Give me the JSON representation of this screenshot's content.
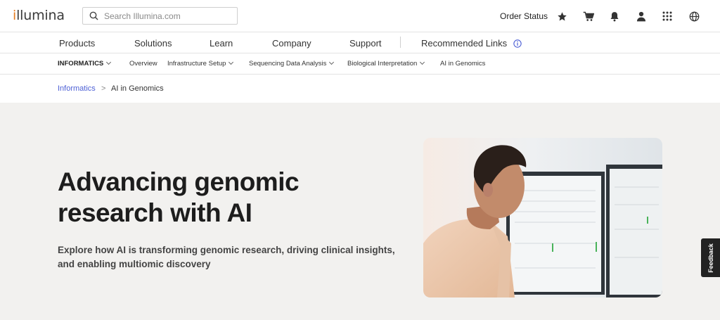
{
  "header": {
    "logo": "illumina",
    "search_placeholder": "Search Illumina.com",
    "order_status": "Order Status",
    "icons": [
      "star-icon",
      "cart-icon",
      "bell-icon",
      "user-icon",
      "apps-grid-icon",
      "globe-icon"
    ]
  },
  "main_nav": {
    "items": [
      "Products",
      "Solutions",
      "Learn",
      "Company",
      "Support"
    ],
    "recommended": "Recommended Links"
  },
  "sub_nav": {
    "section": "INFORMATICS",
    "items": [
      "Overview",
      "Infrastructure Setup",
      "Sequencing Data Analysis",
      "Biological Interpretation",
      "AI in Genomics"
    ]
  },
  "breadcrumb": {
    "parent": "Informatics",
    "separator": ">",
    "current": "AI in Genomics"
  },
  "hero": {
    "title": "Advancing genomic research with AI",
    "subtitle": "Explore how AI is transforming genomic research, driving clinical insights, and enabling multiomic discovery"
  },
  "feedback": "Feedback",
  "colors": {
    "brand_orange": "#e67e22",
    "link_blue": "#4c5fd5",
    "hero_bg": "#f2f1ef"
  }
}
